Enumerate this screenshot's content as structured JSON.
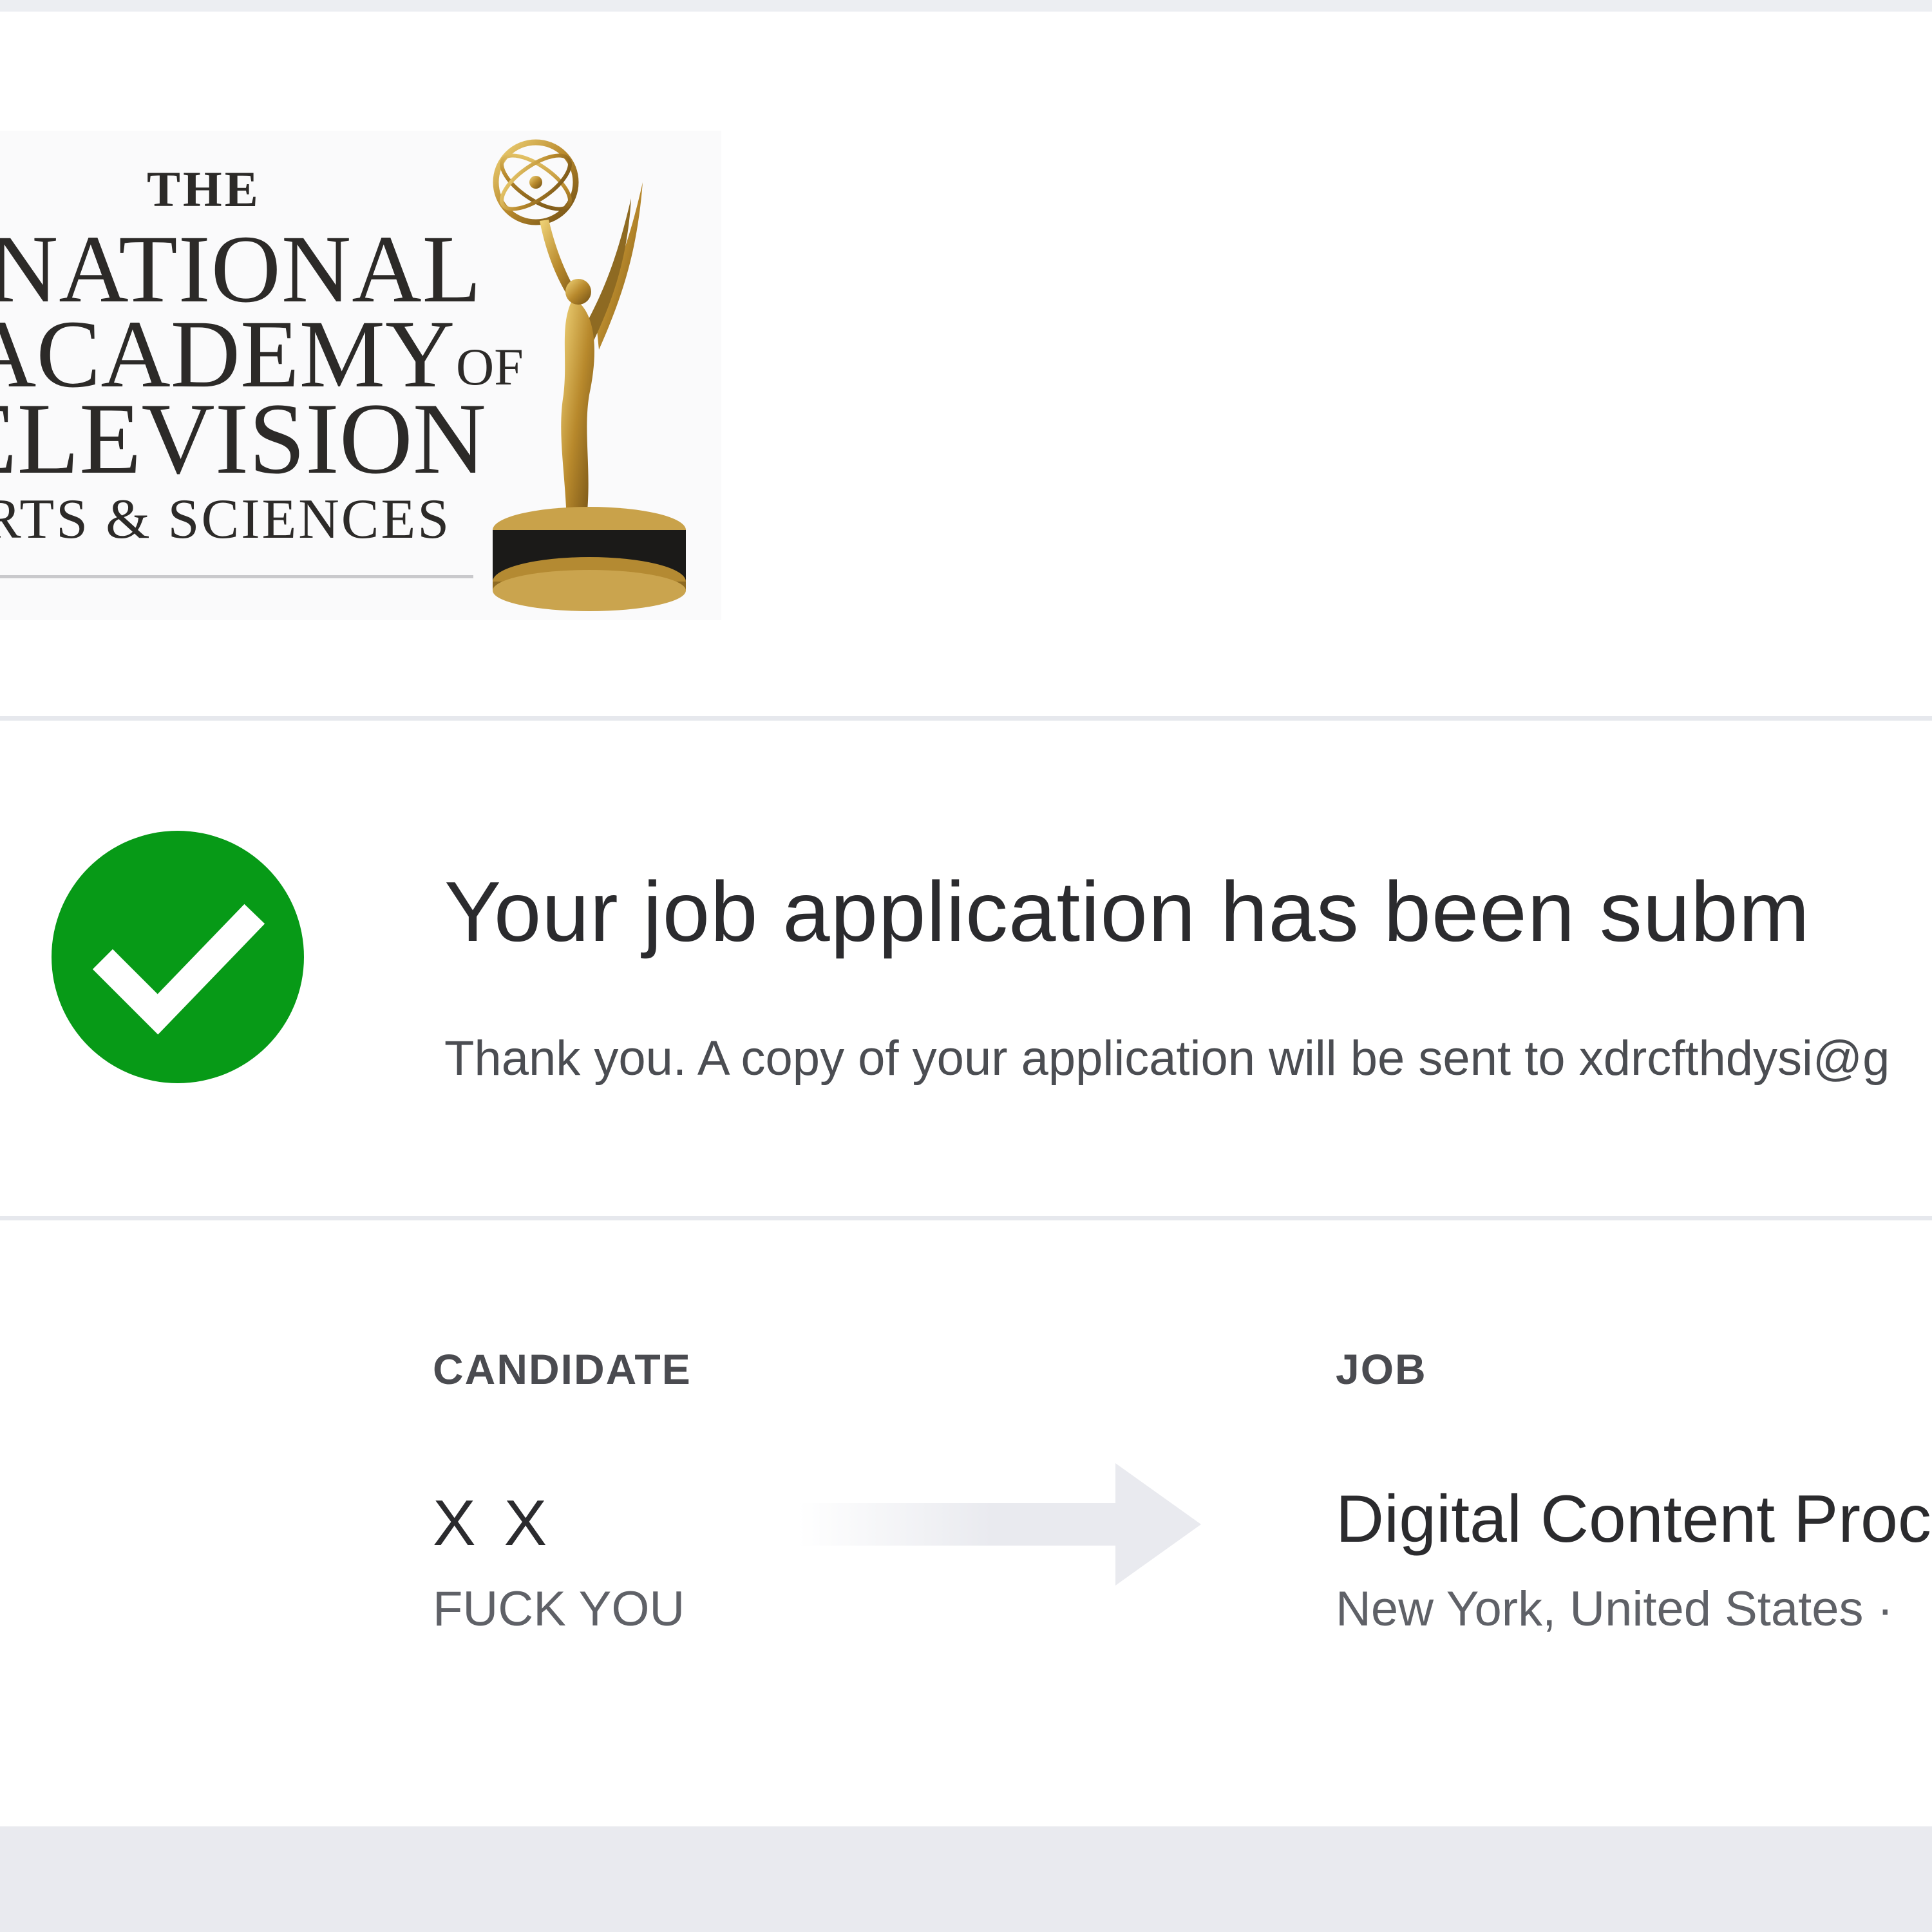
{
  "logo": {
    "line_the": "THE",
    "line_national": "NATIONAL",
    "line_academy": "ACADEMY",
    "line_of": "OF",
    "line_television": "ELEVISION",
    "line_arts": "RTS & SCIENCES",
    "alt": "The National Academy of Television Arts & Sciences"
  },
  "confirmation": {
    "title": "Your job application has been subm",
    "message": "Thank you. A copy of your application will be sent to xdrcfthdysi@g",
    "status_color": "#079a17"
  },
  "candidate": {
    "label": "CANDIDATE",
    "name": "X X",
    "subtitle": "FUCK YOU"
  },
  "job": {
    "label": "JOB",
    "title": "Digital Content Proc",
    "location": "New York, United States ·"
  },
  "icons": {
    "success": "check-circle-icon",
    "transfer": "arrow-right-icon",
    "logo_figure": "emmy-statuette-icon"
  }
}
